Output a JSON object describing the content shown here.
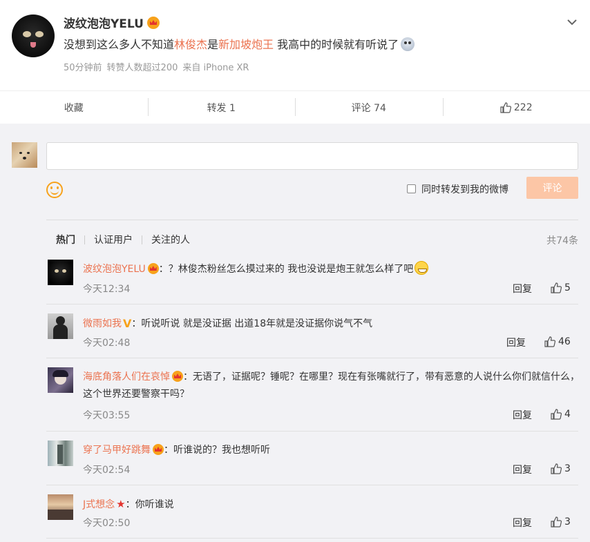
{
  "post": {
    "author": "波纹泡泡YELU",
    "text_before": "没想到这么多人不知道",
    "highlight_1": "林俊杰",
    "text_mid": "是",
    "highlight_2": "新加坡炮王",
    "text_after": " 我高中的时候就有听说了",
    "time": "50分钟前",
    "likes_note": "转赞人数超过200",
    "source": "来自 iPhone XR",
    "icons": {
      "badge": "crown-badge-icon",
      "menu": "chevron-down-icon",
      "emoji": "shocked-face-icon"
    }
  },
  "actions": {
    "favorite": "收藏",
    "repost": "转发 1",
    "comment": "评论 74",
    "like_count": "222"
  },
  "composer": {
    "placeholder": "",
    "repost_option": "同时转发到我的微博",
    "submit": "评论"
  },
  "filters": {
    "hot": "热门",
    "verified": "认证用户",
    "following": "关注的人",
    "total": "共74条"
  },
  "comments": [
    {
      "name": "波纹泡泡YELU",
      "text": "：？林俊杰粉丝怎么摸过来的 我也没说是炮王就怎么样了吧",
      "time": "今天12:34",
      "reply": "回复",
      "likes": "5"
    },
    {
      "name": "微雨如我",
      "text": "：听说听说 就是没证据 出道18年就是没证据你说气不气",
      "time": "今天02:48",
      "reply": "回复",
      "likes": "46"
    },
    {
      "name": "海底角落人们在哀悼",
      "text": "：无语了，证据呢？锤呢？在哪里？现在有张嘴就行了，带有恶意的人说什么你们就信什么，这个世界还要警察干吗？",
      "time": "今天03:55",
      "reply": "回复",
      "likes": "4"
    },
    {
      "name": "穿了马甲好跳舞",
      "text": "：听谁说的？我也想听听",
      "time": "今天02:54",
      "reply": "回复",
      "likes": "3"
    },
    {
      "name": "J式想念",
      "text": "：你听谁说",
      "time": "今天02:50",
      "reply": "回复",
      "likes": "3"
    }
  ],
  "colors": {
    "accent": "#eb7350",
    "submit_disabled": "#fcc6a6",
    "badge": "#f7a21b"
  }
}
